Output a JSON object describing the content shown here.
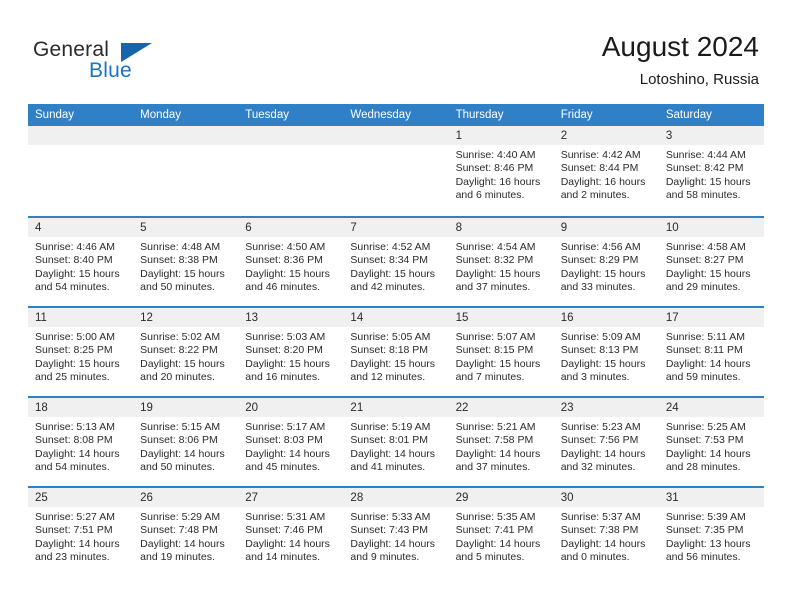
{
  "brand": {
    "name_top": "General",
    "name_bottom": "Blue",
    "accent_color": "#1565ad",
    "text_color": "#2b2b2b"
  },
  "header": {
    "title": "August 2024",
    "location": "Lotoshino, Russia"
  },
  "theme": {
    "header_bar_color": "#3080c8",
    "day_strip_color": "#f0f0f0",
    "separator_color": "#3080c8"
  },
  "weekdays": [
    "Sunday",
    "Monday",
    "Tuesday",
    "Wednesday",
    "Thursday",
    "Friday",
    "Saturday"
  ],
  "weeks": [
    [
      {
        "day": "",
        "lines": []
      },
      {
        "day": "",
        "lines": []
      },
      {
        "day": "",
        "lines": []
      },
      {
        "day": "",
        "lines": []
      },
      {
        "day": "1",
        "lines": [
          "Sunrise: 4:40 AM",
          "Sunset: 8:46 PM",
          "Daylight: 16 hours",
          "and 6 minutes."
        ]
      },
      {
        "day": "2",
        "lines": [
          "Sunrise: 4:42 AM",
          "Sunset: 8:44 PM",
          "Daylight: 16 hours",
          "and 2 minutes."
        ]
      },
      {
        "day": "3",
        "lines": [
          "Sunrise: 4:44 AM",
          "Sunset: 8:42 PM",
          "Daylight: 15 hours",
          "and 58 minutes."
        ]
      }
    ],
    [
      {
        "day": "4",
        "lines": [
          "Sunrise: 4:46 AM",
          "Sunset: 8:40 PM",
          "Daylight: 15 hours",
          "and 54 minutes."
        ]
      },
      {
        "day": "5",
        "lines": [
          "Sunrise: 4:48 AM",
          "Sunset: 8:38 PM",
          "Daylight: 15 hours",
          "and 50 minutes."
        ]
      },
      {
        "day": "6",
        "lines": [
          "Sunrise: 4:50 AM",
          "Sunset: 8:36 PM",
          "Daylight: 15 hours",
          "and 46 minutes."
        ]
      },
      {
        "day": "7",
        "lines": [
          "Sunrise: 4:52 AM",
          "Sunset: 8:34 PM",
          "Daylight: 15 hours",
          "and 42 minutes."
        ]
      },
      {
        "day": "8",
        "lines": [
          "Sunrise: 4:54 AM",
          "Sunset: 8:32 PM",
          "Daylight: 15 hours",
          "and 37 minutes."
        ]
      },
      {
        "day": "9",
        "lines": [
          "Sunrise: 4:56 AM",
          "Sunset: 8:29 PM",
          "Daylight: 15 hours",
          "and 33 minutes."
        ]
      },
      {
        "day": "10",
        "lines": [
          "Sunrise: 4:58 AM",
          "Sunset: 8:27 PM",
          "Daylight: 15 hours",
          "and 29 minutes."
        ]
      }
    ],
    [
      {
        "day": "11",
        "lines": [
          "Sunrise: 5:00 AM",
          "Sunset: 8:25 PM",
          "Daylight: 15 hours",
          "and 25 minutes."
        ]
      },
      {
        "day": "12",
        "lines": [
          "Sunrise: 5:02 AM",
          "Sunset: 8:22 PM",
          "Daylight: 15 hours",
          "and 20 minutes."
        ]
      },
      {
        "day": "13",
        "lines": [
          "Sunrise: 5:03 AM",
          "Sunset: 8:20 PM",
          "Daylight: 15 hours",
          "and 16 minutes."
        ]
      },
      {
        "day": "14",
        "lines": [
          "Sunrise: 5:05 AM",
          "Sunset: 8:18 PM",
          "Daylight: 15 hours",
          "and 12 minutes."
        ]
      },
      {
        "day": "15",
        "lines": [
          "Sunrise: 5:07 AM",
          "Sunset: 8:15 PM",
          "Daylight: 15 hours",
          "and 7 minutes."
        ]
      },
      {
        "day": "16",
        "lines": [
          "Sunrise: 5:09 AM",
          "Sunset: 8:13 PM",
          "Daylight: 15 hours",
          "and 3 minutes."
        ]
      },
      {
        "day": "17",
        "lines": [
          "Sunrise: 5:11 AM",
          "Sunset: 8:11 PM",
          "Daylight: 14 hours",
          "and 59 minutes."
        ]
      }
    ],
    [
      {
        "day": "18",
        "lines": [
          "Sunrise: 5:13 AM",
          "Sunset: 8:08 PM",
          "Daylight: 14 hours",
          "and 54 minutes."
        ]
      },
      {
        "day": "19",
        "lines": [
          "Sunrise: 5:15 AM",
          "Sunset: 8:06 PM",
          "Daylight: 14 hours",
          "and 50 minutes."
        ]
      },
      {
        "day": "20",
        "lines": [
          "Sunrise: 5:17 AM",
          "Sunset: 8:03 PM",
          "Daylight: 14 hours",
          "and 45 minutes."
        ]
      },
      {
        "day": "21",
        "lines": [
          "Sunrise: 5:19 AM",
          "Sunset: 8:01 PM",
          "Daylight: 14 hours",
          "and 41 minutes."
        ]
      },
      {
        "day": "22",
        "lines": [
          "Sunrise: 5:21 AM",
          "Sunset: 7:58 PM",
          "Daylight: 14 hours",
          "and 37 minutes."
        ]
      },
      {
        "day": "23",
        "lines": [
          "Sunrise: 5:23 AM",
          "Sunset: 7:56 PM",
          "Daylight: 14 hours",
          "and 32 minutes."
        ]
      },
      {
        "day": "24",
        "lines": [
          "Sunrise: 5:25 AM",
          "Sunset: 7:53 PM",
          "Daylight: 14 hours",
          "and 28 minutes."
        ]
      }
    ],
    [
      {
        "day": "25",
        "lines": [
          "Sunrise: 5:27 AM",
          "Sunset: 7:51 PM",
          "Daylight: 14 hours",
          "and 23 minutes."
        ]
      },
      {
        "day": "26",
        "lines": [
          "Sunrise: 5:29 AM",
          "Sunset: 7:48 PM",
          "Daylight: 14 hours",
          "and 19 minutes."
        ]
      },
      {
        "day": "27",
        "lines": [
          "Sunrise: 5:31 AM",
          "Sunset: 7:46 PM",
          "Daylight: 14 hours",
          "and 14 minutes."
        ]
      },
      {
        "day": "28",
        "lines": [
          "Sunrise: 5:33 AM",
          "Sunset: 7:43 PM",
          "Daylight: 14 hours",
          "and 9 minutes."
        ]
      },
      {
        "day": "29",
        "lines": [
          "Sunrise: 5:35 AM",
          "Sunset: 7:41 PM",
          "Daylight: 14 hours",
          "and 5 minutes."
        ]
      },
      {
        "day": "30",
        "lines": [
          "Sunrise: 5:37 AM",
          "Sunset: 7:38 PM",
          "Daylight: 14 hours",
          "and 0 minutes."
        ]
      },
      {
        "day": "31",
        "lines": [
          "Sunrise: 5:39 AM",
          "Sunset: 7:35 PM",
          "Daylight: 13 hours",
          "and 56 minutes."
        ]
      }
    ]
  ]
}
